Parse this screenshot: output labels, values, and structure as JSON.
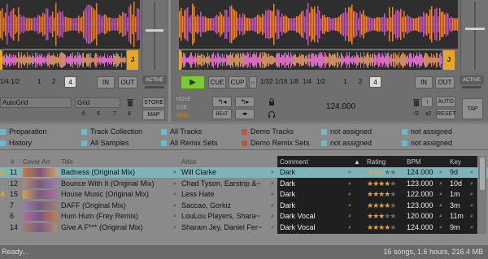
{
  "deck_left": {
    "loop_sizes": [
      "1/4",
      "1/2",
      "1",
      "2",
      "4"
    ],
    "selected_loop": "4",
    "in_label": "IN",
    "out_label": "OUT",
    "active_label": "ACTIVE",
    "deck_letter": "J",
    "grid_mode": "AutoGrid",
    "grid_type": "Grid",
    "store_label": "STORE",
    "map_label": "MAP",
    "hotcues": [
      "5",
      "6",
      "7",
      "8"
    ]
  },
  "deck_right": {
    "play_label": "▶",
    "cue_label": "CUE",
    "cup_label": "CUP",
    "loop_sizes": [
      "1/32",
      "1/16",
      "1/8",
      "1/4",
      "1/2",
      "1",
      "2",
      "4"
    ],
    "selected_loop": "2",
    "in_label": "IN",
    "out_label": "OUT",
    "active_label": "ACTIVE",
    "deck_letter": "J",
    "move_label": "MOVE",
    "cue_small_label": "CUE",
    "grid_small_label": "GRID",
    "beat_label": "BEAT",
    "bpm": "124.000",
    "auto_label": "AUTO",
    "x2_label": "x2",
    "div2_label": "/2",
    "reset_label": "RESET",
    "tap_label": "TAP",
    "minus_label": "-"
  },
  "favorites": [
    {
      "label": "Preparation",
      "icon": "playlist-icon"
    },
    {
      "label": "Track Collection",
      "icon": "playlist-icon"
    },
    {
      "label": "All Tracks",
      "icon": "playlist-icon"
    },
    {
      "label": "Demo Tracks",
      "icon": "demo-icon"
    },
    {
      "label": "not assigned",
      "icon": "slot-icon"
    },
    {
      "label": "not assigned",
      "icon": "slot-icon"
    },
    {
      "label": "History",
      "icon": "playlist-icon"
    },
    {
      "label": "All Samples",
      "icon": "playlist-icon"
    },
    {
      "label": "All Remix Sets",
      "icon": "playlist-icon"
    },
    {
      "label": "Demo Remix Sets",
      "icon": "demo-icon"
    },
    {
      "label": "not assigned",
      "icon": "slot-icon"
    },
    {
      "label": "not assigned",
      "icon": "slot-icon"
    }
  ],
  "table": {
    "headers": {
      "num": "#",
      "cover": "Cover Art",
      "title": "Title",
      "artist": "Artist",
      "comment": "Comment",
      "rating": "Rating",
      "bpm": "BPM",
      "key": "Key"
    },
    "rows": [
      {
        "deck": "B",
        "num": "11",
        "title": "Badness (Original Mix)",
        "artist": "Will Clarke",
        "comment": "Dark",
        "rating": 3,
        "bpm": "124.000",
        "key": "9d",
        "selected": true
      },
      {
        "deck": "",
        "num": "12",
        "title": "Bounce With It (Original Mix)",
        "artist": "Chad Tyson, Earstrip &~",
        "comment": "Dark",
        "rating": 4,
        "bpm": "123.000",
        "key": "10d",
        "selected": false
      },
      {
        "deck": "A",
        "num": "15",
        "title": "House Music (Original Mix)",
        "artist": "Less Hate",
        "comment": "Dark",
        "rating": 4,
        "bpm": "122.000",
        "key": "1m",
        "selected": false
      },
      {
        "deck": "",
        "num": "7",
        "title": "DAFF (Original Mix)",
        "artist": "Saccao, Gorkiz",
        "comment": "Dark",
        "rating": 4,
        "bpm": "123.000",
        "key": "3m",
        "selected": false
      },
      {
        "deck": "",
        "num": "6",
        "title": "Hum Hum (Frey Remix)",
        "artist": "LouLou Players, Shara~",
        "comment": "Dark Vocal",
        "rating": 3,
        "bpm": "120.000",
        "key": "11m",
        "selected": false
      },
      {
        "deck": "",
        "num": "14",
        "title": "Give A F*** (Original Mix)",
        "artist": "Sharam Jey, Daniel Fer~",
        "comment": "Dark Vocal",
        "rating": 4,
        "bpm": "124.000",
        "key": "9m",
        "selected": false
      }
    ]
  },
  "status": {
    "left": "Ready...",
    "right": "16 songs, 1.6 hours, 216.4 MB"
  },
  "colors": {
    "accent_orange": "#e6a62a",
    "play_green": "#7ec83c",
    "selected_row": "#7fb3b8",
    "highlight_panel": "#1c1c1c"
  }
}
